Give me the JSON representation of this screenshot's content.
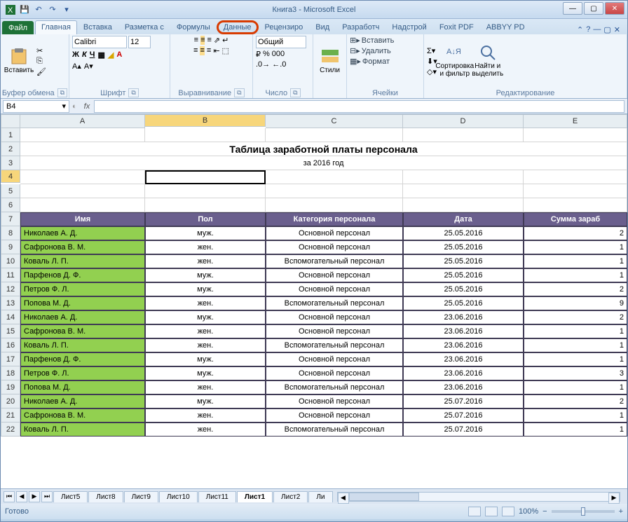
{
  "title": "Книга3 - Microsoft Excel",
  "qat": {
    "save": "💾",
    "undo": "↶",
    "redo": "↷"
  },
  "tabs": {
    "file": "Файл",
    "items": [
      "Главная",
      "Вставка",
      "Разметка с",
      "Формулы",
      "Данные",
      "Рецензиро",
      "Вид",
      "Разработч",
      "Надстрой",
      "Foxit PDF",
      "ABBYY PD"
    ],
    "active": 0,
    "highlight": 4
  },
  "ribbon": {
    "clipboard": {
      "label": "Буфер обмена",
      "paste": "Вставить"
    },
    "font": {
      "label": "Шрифт",
      "name": "Calibri",
      "size": "12"
    },
    "align": {
      "label": "Выравнивание"
    },
    "number": {
      "label": "Число",
      "format": "Общий"
    },
    "styles": {
      "label": "",
      "btn": "Стили"
    },
    "cells": {
      "label": "Ячейки",
      "insert": "Вставить",
      "delete": "Удалить",
      "format": "Формат"
    },
    "editing": {
      "label": "Редактирование",
      "sort": "Сортировка и фильтр",
      "find": "Найти и выделить"
    }
  },
  "namebox": "B4",
  "sheet": {
    "cols": [
      "A",
      "B",
      "C",
      "D",
      "E"
    ],
    "title": "Таблица заработной платы персонала",
    "subtitle": "за 2016 год",
    "headers": [
      "Имя",
      "Пол",
      "Категория персонала",
      "Дата",
      "Сумма зараб"
    ],
    "rows": [
      {
        "n": 8,
        "name": "Николаев А. Д.",
        "sex": "муж.",
        "cat": "Основной персонал",
        "date": "25.05.2016",
        "sum": "2"
      },
      {
        "n": 9,
        "name": "Сафронова В. М.",
        "sex": "жен.",
        "cat": "Основной персонал",
        "date": "25.05.2016",
        "sum": "1"
      },
      {
        "n": 10,
        "name": "Коваль Л. П.",
        "sex": "жен.",
        "cat": "Вспомогательный персонал",
        "date": "25.05.2016",
        "sum": "1"
      },
      {
        "n": 11,
        "name": "Парфенов Д. Ф.",
        "sex": "муж.",
        "cat": "Основной персонал",
        "date": "25.05.2016",
        "sum": "1"
      },
      {
        "n": 12,
        "name": "Петров Ф. Л.",
        "sex": "муж.",
        "cat": "Основной персонал",
        "date": "25.05.2016",
        "sum": "2"
      },
      {
        "n": 13,
        "name": "Попова М. Д.",
        "sex": "жен.",
        "cat": "Вспомогательный персонал",
        "date": "25.05.2016",
        "sum": "9"
      },
      {
        "n": 14,
        "name": "Николаев А. Д.",
        "sex": "муж.",
        "cat": "Основной персонал",
        "date": "23.06.2016",
        "sum": "2"
      },
      {
        "n": 15,
        "name": "Сафронова В. М.",
        "sex": "жен.",
        "cat": "Основной персонал",
        "date": "23.06.2016",
        "sum": "1"
      },
      {
        "n": 16,
        "name": "Коваль Л. П.",
        "sex": "жен.",
        "cat": "Вспомогательный персонал",
        "date": "23.06.2016",
        "sum": "1"
      },
      {
        "n": 17,
        "name": "Парфенов Д. Ф.",
        "sex": "муж.",
        "cat": "Основной персонал",
        "date": "23.06.2016",
        "sum": "1"
      },
      {
        "n": 18,
        "name": "Петров Ф. Л.",
        "sex": "муж.",
        "cat": "Основной персонал",
        "date": "23.06.2016",
        "sum": "3"
      },
      {
        "n": 19,
        "name": "Попова М. Д.",
        "sex": "жен.",
        "cat": "Вспомогательный персонал",
        "date": "23.06.2016",
        "sum": "1"
      },
      {
        "n": 20,
        "name": "Николаев А. Д.",
        "sex": "муж.",
        "cat": "Основной персонал",
        "date": "25.07.2016",
        "sum": "2"
      },
      {
        "n": 21,
        "name": "Сафронова В. М.",
        "sex": "жен.",
        "cat": "Основной персонал",
        "date": "25.07.2016",
        "sum": "1"
      },
      {
        "n": 22,
        "name": "Коваль Л. П.",
        "sex": "жен.",
        "cat": "Вспомогательный персонал",
        "date": "25.07.2016",
        "sum": "1"
      }
    ]
  },
  "sheettabs": [
    "Лист5",
    "Лист8",
    "Лист9",
    "Лист10",
    "Лист11",
    "Лист1",
    "Лист2",
    "Ли"
  ],
  "active_sheet": 5,
  "status": "Готово",
  "zoom": "100%"
}
